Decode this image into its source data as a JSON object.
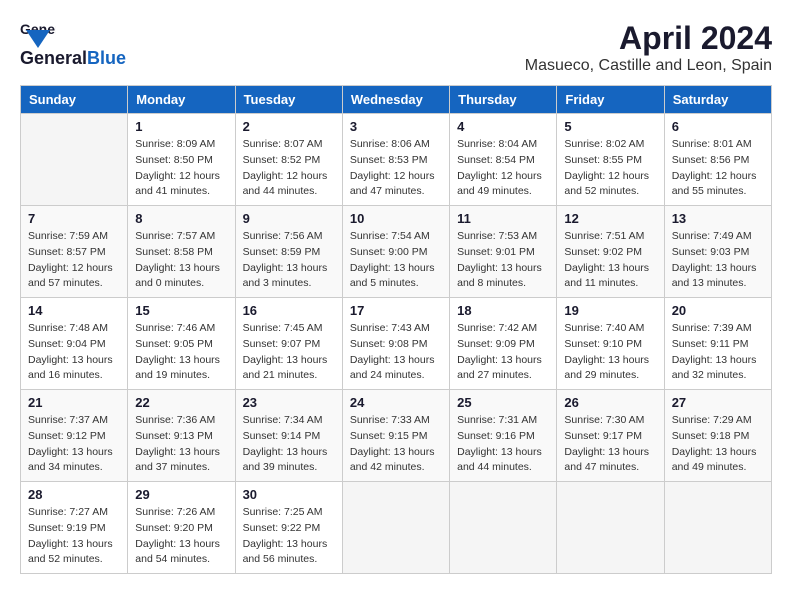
{
  "header": {
    "logo_general": "General",
    "logo_blue": "Blue",
    "title": "April 2024",
    "location": "Masueco, Castille and Leon, Spain"
  },
  "columns": [
    "Sunday",
    "Monday",
    "Tuesday",
    "Wednesday",
    "Thursday",
    "Friday",
    "Saturday"
  ],
  "weeks": [
    [
      {
        "day": "",
        "info": ""
      },
      {
        "day": "1",
        "info": "Sunrise: 8:09 AM\nSunset: 8:50 PM\nDaylight: 12 hours\nand 41 minutes."
      },
      {
        "day": "2",
        "info": "Sunrise: 8:07 AM\nSunset: 8:52 PM\nDaylight: 12 hours\nand 44 minutes."
      },
      {
        "day": "3",
        "info": "Sunrise: 8:06 AM\nSunset: 8:53 PM\nDaylight: 12 hours\nand 47 minutes."
      },
      {
        "day": "4",
        "info": "Sunrise: 8:04 AM\nSunset: 8:54 PM\nDaylight: 12 hours\nand 49 minutes."
      },
      {
        "day": "5",
        "info": "Sunrise: 8:02 AM\nSunset: 8:55 PM\nDaylight: 12 hours\nand 52 minutes."
      },
      {
        "day": "6",
        "info": "Sunrise: 8:01 AM\nSunset: 8:56 PM\nDaylight: 12 hours\nand 55 minutes."
      }
    ],
    [
      {
        "day": "7",
        "info": "Sunrise: 7:59 AM\nSunset: 8:57 PM\nDaylight: 12 hours\nand 57 minutes."
      },
      {
        "day": "8",
        "info": "Sunrise: 7:57 AM\nSunset: 8:58 PM\nDaylight: 13 hours\nand 0 minutes."
      },
      {
        "day": "9",
        "info": "Sunrise: 7:56 AM\nSunset: 8:59 PM\nDaylight: 13 hours\nand 3 minutes."
      },
      {
        "day": "10",
        "info": "Sunrise: 7:54 AM\nSunset: 9:00 PM\nDaylight: 13 hours\nand 5 minutes."
      },
      {
        "day": "11",
        "info": "Sunrise: 7:53 AM\nSunset: 9:01 PM\nDaylight: 13 hours\nand 8 minutes."
      },
      {
        "day": "12",
        "info": "Sunrise: 7:51 AM\nSunset: 9:02 PM\nDaylight: 13 hours\nand 11 minutes."
      },
      {
        "day": "13",
        "info": "Sunrise: 7:49 AM\nSunset: 9:03 PM\nDaylight: 13 hours\nand 13 minutes."
      }
    ],
    [
      {
        "day": "14",
        "info": "Sunrise: 7:48 AM\nSunset: 9:04 PM\nDaylight: 13 hours\nand 16 minutes."
      },
      {
        "day": "15",
        "info": "Sunrise: 7:46 AM\nSunset: 9:05 PM\nDaylight: 13 hours\nand 19 minutes."
      },
      {
        "day": "16",
        "info": "Sunrise: 7:45 AM\nSunset: 9:07 PM\nDaylight: 13 hours\nand 21 minutes."
      },
      {
        "day": "17",
        "info": "Sunrise: 7:43 AM\nSunset: 9:08 PM\nDaylight: 13 hours\nand 24 minutes."
      },
      {
        "day": "18",
        "info": "Sunrise: 7:42 AM\nSunset: 9:09 PM\nDaylight: 13 hours\nand 27 minutes."
      },
      {
        "day": "19",
        "info": "Sunrise: 7:40 AM\nSunset: 9:10 PM\nDaylight: 13 hours\nand 29 minutes."
      },
      {
        "day": "20",
        "info": "Sunrise: 7:39 AM\nSunset: 9:11 PM\nDaylight: 13 hours\nand 32 minutes."
      }
    ],
    [
      {
        "day": "21",
        "info": "Sunrise: 7:37 AM\nSunset: 9:12 PM\nDaylight: 13 hours\nand 34 minutes."
      },
      {
        "day": "22",
        "info": "Sunrise: 7:36 AM\nSunset: 9:13 PM\nDaylight: 13 hours\nand 37 minutes."
      },
      {
        "day": "23",
        "info": "Sunrise: 7:34 AM\nSunset: 9:14 PM\nDaylight: 13 hours\nand 39 minutes."
      },
      {
        "day": "24",
        "info": "Sunrise: 7:33 AM\nSunset: 9:15 PM\nDaylight: 13 hours\nand 42 minutes."
      },
      {
        "day": "25",
        "info": "Sunrise: 7:31 AM\nSunset: 9:16 PM\nDaylight: 13 hours\nand 44 minutes."
      },
      {
        "day": "26",
        "info": "Sunrise: 7:30 AM\nSunset: 9:17 PM\nDaylight: 13 hours\nand 47 minutes."
      },
      {
        "day": "27",
        "info": "Sunrise: 7:29 AM\nSunset: 9:18 PM\nDaylight: 13 hours\nand 49 minutes."
      }
    ],
    [
      {
        "day": "28",
        "info": "Sunrise: 7:27 AM\nSunset: 9:19 PM\nDaylight: 13 hours\nand 52 minutes."
      },
      {
        "day": "29",
        "info": "Sunrise: 7:26 AM\nSunset: 9:20 PM\nDaylight: 13 hours\nand 54 minutes."
      },
      {
        "day": "30",
        "info": "Sunrise: 7:25 AM\nSunset: 9:22 PM\nDaylight: 13 hours\nand 56 minutes."
      },
      {
        "day": "",
        "info": ""
      },
      {
        "day": "",
        "info": ""
      },
      {
        "day": "",
        "info": ""
      },
      {
        "day": "",
        "info": ""
      }
    ]
  ]
}
